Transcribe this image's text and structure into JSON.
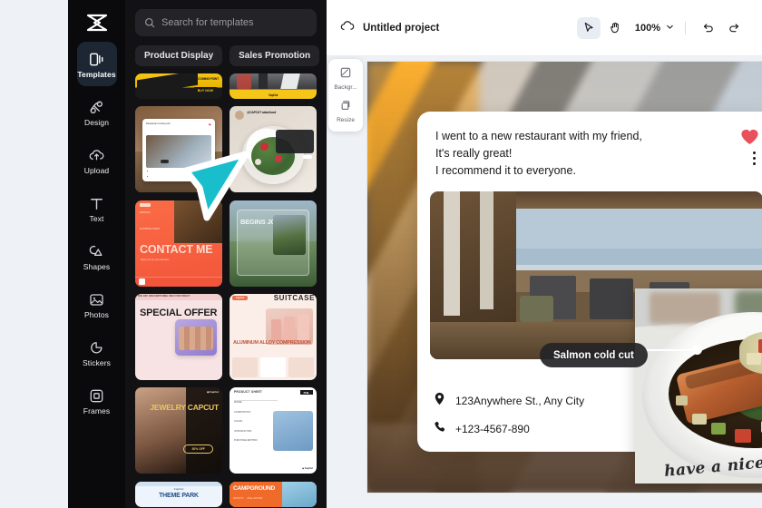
{
  "app": {
    "logo_icon": "capcut-logo-icon",
    "accent_cyan": "#19becd",
    "heart_color": "#e8505b"
  },
  "sidebar": {
    "items": [
      {
        "label": "Templates",
        "icon": "templates-icon",
        "active": true
      },
      {
        "label": "Design",
        "icon": "design-icon",
        "active": false
      },
      {
        "label": "Upload",
        "icon": "upload-cloud-icon",
        "active": false
      },
      {
        "label": "Text",
        "icon": "text-icon",
        "active": false
      },
      {
        "label": "Shapes",
        "icon": "shapes-icon",
        "active": false
      },
      {
        "label": "Photos",
        "icon": "photos-icon",
        "active": false
      },
      {
        "label": "Stickers",
        "icon": "stickers-icon",
        "active": false
      },
      {
        "label": "Frames",
        "icon": "frames-icon",
        "active": false
      }
    ]
  },
  "panel": {
    "search": {
      "placeholder": "Search for templates",
      "value": "",
      "icon": "search-icon"
    },
    "chips": [
      {
        "label": "Product Display"
      },
      {
        "label": "Sales Promotion"
      }
    ],
    "templates": [
      {
        "title": "PRODUCT COMING POINT",
        "cta": "BUY NOW",
        "style": "auto-yellow-left"
      },
      {
        "title": "CapCut",
        "style": "auto-yellow-right"
      },
      {
        "title": "Restaurant review post",
        "style": "restaurant-post"
      },
      {
        "title": "@CAPCUT salad bowl",
        "style": "salad-post"
      },
      {
        "title": "CONTACT ME",
        "subtitle": "thank you for your attention",
        "style": "contact-orange"
      },
      {
        "title": "BEGINS JOURNEY",
        "style": "journey-mountain"
      },
      {
        "title": "SPECIAL OFFER",
        "subtitle": "50% OFF ON EVERYTHING ONLY FOR TODAY!",
        "style": "offer-pink"
      },
      {
        "title": "SUITCASE",
        "subtitle": "ALUMINUM ALLOY COMPRESSION",
        "style": "suitcase-pink"
      },
      {
        "title": "JEWELRY CAPCUT",
        "badge": "30% OFF",
        "style": "jewelry-dark"
      },
      {
        "title": "PRODUCT SHEET",
        "style": "product-sheet"
      },
      {
        "title": "THEME PARK",
        "style": "theme-park"
      },
      {
        "title": "CAMPGROUND",
        "style": "campground"
      }
    ]
  },
  "topbar": {
    "cloud_icon": "cloud-save-icon",
    "project_name": "Untitled project",
    "select_tool": {
      "icon": "cursor-select-icon",
      "active": true
    },
    "hand_tool": {
      "icon": "hand-pan-icon",
      "active": false
    },
    "zoom_level": "100%",
    "zoom_caret_icon": "chevron-down-icon",
    "undo_icon": "undo-icon",
    "redo_icon": "redo-icon"
  },
  "float_panel": {
    "items": [
      {
        "label": "Backgr...",
        "icon": "background-icon"
      },
      {
        "label": "Resize",
        "icon": "resize-icon"
      }
    ]
  },
  "canvas": {
    "post": {
      "lines": [
        "I went to a new restaurant with my friend,",
        "It's really great!",
        "I recommend it to everyone."
      ],
      "heart_icon": "heart-filled-icon",
      "more_icon": "more-vertical-icon",
      "address": {
        "icon": "location-pin-icon",
        "text": "123Anywhere St., Any City"
      },
      "phone": {
        "icon": "phone-icon",
        "text": "+123-4567-890"
      }
    },
    "pill_label": "Salmon cold cut",
    "handwriting": "have a nice day!"
  },
  "cursor": {
    "icon": "mouse-pointer-icon",
    "color": "#19becd"
  }
}
